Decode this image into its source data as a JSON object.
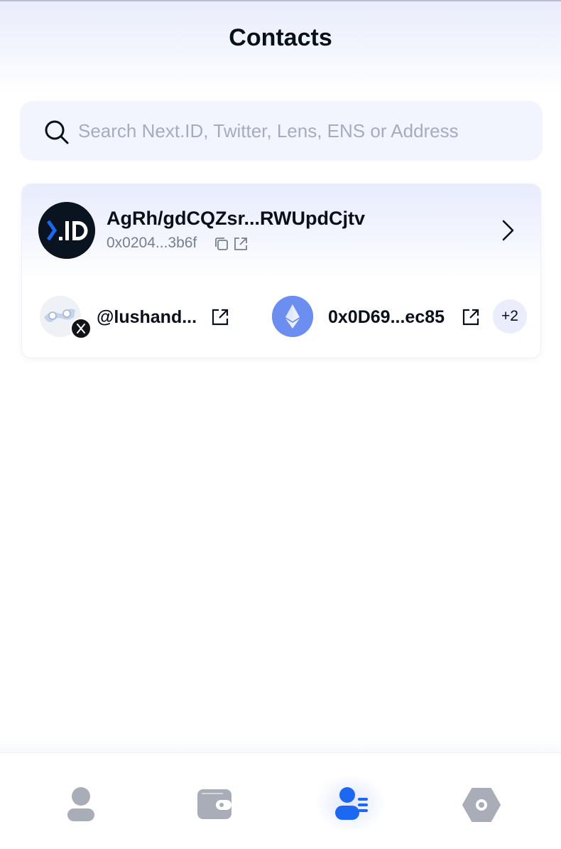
{
  "header": {
    "title": "Contacts"
  },
  "search": {
    "placeholder": "Search Next.ID, Twitter, Lens, ENS or Address",
    "value": ""
  },
  "contact": {
    "avatar_icon": "nextid-logo-icon",
    "name": "AgRh/gdCQZsr...RWUpdCjtv",
    "address": "0x0204...3b6f",
    "identities": [
      {
        "platform": "twitter",
        "handle": "@lushand...",
        "icon": "x-logo-icon"
      },
      {
        "platform": "ethereum",
        "handle": "0x0D69...ec85",
        "icon": "ethereum-icon"
      }
    ],
    "more_count": "+2"
  },
  "bottom_nav": {
    "items": [
      {
        "name": "profile",
        "icon": "user-icon",
        "active": false
      },
      {
        "name": "wallet",
        "icon": "wallet-icon",
        "active": false
      },
      {
        "name": "contacts",
        "icon": "contacts-icon",
        "active": true
      },
      {
        "name": "settings",
        "icon": "settings-icon",
        "active": false
      }
    ]
  },
  "colors": {
    "accent": "#1c68f3",
    "nav_inactive": "#a9adb8",
    "text_primary": "#07101b",
    "text_secondary": "#767f8d",
    "placeholder": "#a6abc0",
    "search_bg": "#f2f5fe"
  }
}
